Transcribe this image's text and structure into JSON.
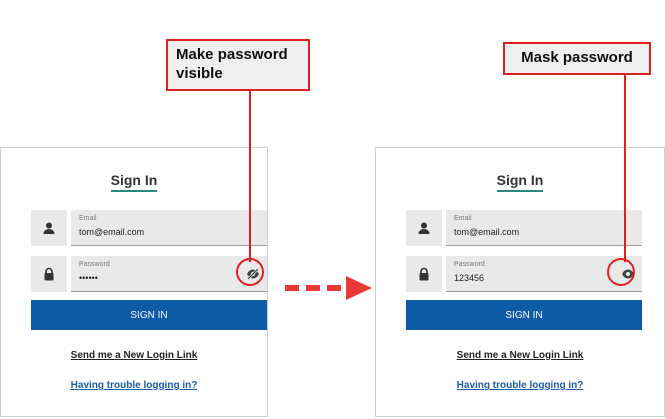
{
  "left_panel": {
    "title": "Sign In",
    "email_label": "Email",
    "email_value": "tom@email.com",
    "password_label": "Password",
    "password_value": "••••••",
    "signin_label": "SIGN IN",
    "new_login_link": "Send me a New Login Link",
    "trouble_link": "Having trouble logging in?"
  },
  "right_panel": {
    "title": "Sign In",
    "email_label": "Email",
    "email_value": "tom@email.com",
    "password_label": "Password",
    "password_value": "123456",
    "signin_label": "SIGN IN",
    "new_login_link": "Send me a New Login Link",
    "trouble_link": "Having trouble logging in?"
  },
  "callouts": {
    "left": "Make password visible",
    "right": "Mask password"
  },
  "icons": {
    "user": "user-icon",
    "lock": "lock-icon",
    "eye_off": "eye-off-icon",
    "eye": "eye-icon",
    "arrow": "dashed-arrow-right"
  },
  "colors": {
    "primary": "#0d5aa7",
    "accent_red": "#e02020",
    "link_blue": "#1a5ea8",
    "title_underline": "#2a8a7a"
  }
}
